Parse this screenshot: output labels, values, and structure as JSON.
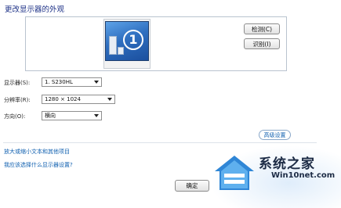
{
  "header": {
    "title": "更改显示器的外观"
  },
  "preview": {
    "monitor_number": "1",
    "detect_label": "检测(C)",
    "identify_label": "识别(I)"
  },
  "settings": {
    "display": {
      "label": "显示器(S):",
      "value": "1. S230HL"
    },
    "resolution": {
      "label": "分辨率(R):",
      "value": "1280 × 1024"
    },
    "orientation": {
      "label": "方向(O):",
      "value": "横向"
    },
    "advanced_label": "高级设置"
  },
  "links": {
    "text_size": "放大或缩小文本和其他项目",
    "which_settings": "我应该选择什么显示器设置?"
  },
  "footer": {
    "ok_label": "确定"
  },
  "watermark": {
    "name": "系统之家",
    "domain": "Win10net.com"
  },
  "colors": {
    "title": "#1e3287",
    "link": "#1060b0",
    "screen": "#2f6fc0"
  }
}
